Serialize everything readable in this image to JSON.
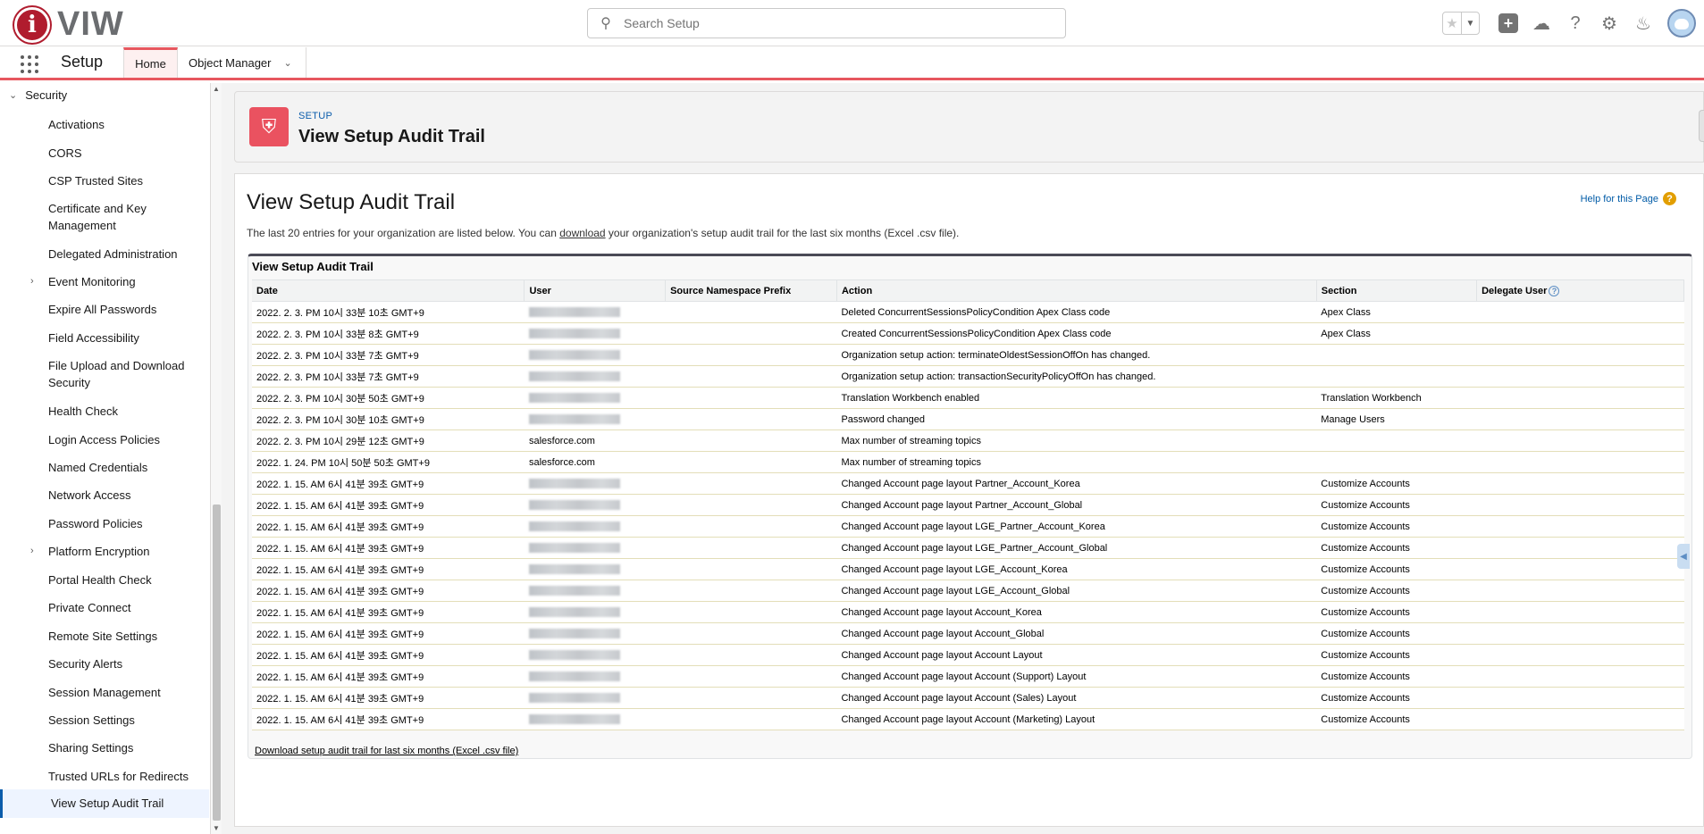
{
  "header": {
    "logo_letter": "i",
    "logo_text": "VIW",
    "search_placeholder": "Search Setup",
    "icons": [
      "star-icon",
      "chevron-down-icon",
      "plus-icon",
      "trailhead-icon",
      "help-icon",
      "gear-icon",
      "bell-icon",
      "avatar"
    ]
  },
  "context_bar": {
    "app_name": "Setup",
    "tabs": [
      {
        "label": "Home",
        "active": true
      },
      {
        "label": "Object Manager",
        "active": false
      }
    ]
  },
  "sidebar": {
    "group_label": "Security",
    "items": [
      {
        "label": "Activations"
      },
      {
        "label": "CORS"
      },
      {
        "label": "CSP Trusted Sites"
      },
      {
        "label": "Certificate and Key Management"
      },
      {
        "label": "Delegated Administration"
      },
      {
        "label": "Event Monitoring",
        "expandable": true
      },
      {
        "label": "Expire All Passwords"
      },
      {
        "label": "Field Accessibility"
      },
      {
        "label": "File Upload and Download Security"
      },
      {
        "label": "Health Check"
      },
      {
        "label": "Login Access Policies"
      },
      {
        "label": "Named Credentials"
      },
      {
        "label": "Network Access"
      },
      {
        "label": "Password Policies"
      },
      {
        "label": "Platform Encryption",
        "expandable": true
      },
      {
        "label": "Portal Health Check"
      },
      {
        "label": "Private Connect"
      },
      {
        "label": "Remote Site Settings"
      },
      {
        "label": "Security Alerts"
      },
      {
        "label": "Session Management"
      },
      {
        "label": "Session Settings"
      },
      {
        "label": "Sharing Settings"
      },
      {
        "label": "Trusted URLs for Redirects"
      },
      {
        "label": "View Setup Audit Trail",
        "active": true
      }
    ]
  },
  "page_header": {
    "eyebrow": "SETUP",
    "title": "View Setup Audit Trail"
  },
  "content": {
    "title": "View Setup Audit Trail",
    "help_link": "Help for this Page",
    "intro_before": "The last 20 entries for your organization are listed below. You can ",
    "intro_link": "download",
    "intro_after": " your organization's setup audit trail for the last six months (Excel .csv file).",
    "block_title": "View Setup Audit Trail",
    "columns": [
      "Date",
      "User",
      "Source Namespace Prefix",
      "Action",
      "Section",
      "Delegate User"
    ],
    "rows": [
      {
        "date": "2022. 2. 3. PM 10시 33분 10초 GMT+9",
        "user": "",
        "prefix": "",
        "action": "Deleted ConcurrentSessionsPolicyCondition Apex Class code",
        "section": "Apex Class",
        "delegate": ""
      },
      {
        "date": "2022. 2. 3. PM 10시 33분 8초 GMT+9",
        "user": "",
        "prefix": "",
        "action": "Created ConcurrentSessionsPolicyCondition Apex Class code",
        "section": "Apex Class",
        "delegate": ""
      },
      {
        "date": "2022. 2. 3. PM 10시 33분 7초 GMT+9",
        "user": "",
        "prefix": "",
        "action": "Organization setup action: terminateOldestSessionOffOn has changed.",
        "section": "",
        "delegate": ""
      },
      {
        "date": "2022. 2. 3. PM 10시 33분 7초 GMT+9",
        "user": "",
        "prefix": "",
        "action": "Organization setup action: transactionSecurityPolicyOffOn has changed.",
        "section": "",
        "delegate": ""
      },
      {
        "date": "2022. 2. 3. PM 10시 30분 50초 GMT+9",
        "user": "",
        "prefix": "",
        "action": "Translation Workbench enabled",
        "section": "Translation Workbench",
        "delegate": ""
      },
      {
        "date": "2022. 2. 3. PM 10시 30분 10초 GMT+9",
        "user": "",
        "prefix": "",
        "action": "Password changed",
        "section": "Manage Users",
        "delegate": ""
      },
      {
        "date": "2022. 2. 3. PM 10시 29분 12초 GMT+9",
        "user": "salesforce.com",
        "prefix": "",
        "action": "Max number of streaming topics",
        "section": "",
        "delegate": ""
      },
      {
        "date": "2022. 1. 24. PM 10시 50분 50초 GMT+9",
        "user": "salesforce.com",
        "prefix": "",
        "action": "Max number of streaming topics",
        "section": "",
        "delegate": ""
      },
      {
        "date": "2022. 1. 15. AM 6시 41분 39초 GMT+9",
        "user": "",
        "prefix": "",
        "action": "Changed Account page layout Partner_Account_Korea",
        "section": "Customize Accounts",
        "delegate": ""
      },
      {
        "date": "2022. 1. 15. AM 6시 41분 39초 GMT+9",
        "user": "",
        "prefix": "",
        "action": "Changed Account page layout Partner_Account_Global",
        "section": "Customize Accounts",
        "delegate": ""
      },
      {
        "date": "2022. 1. 15. AM 6시 41분 39초 GMT+9",
        "user": "",
        "prefix": "",
        "action": "Changed Account page layout LGE_Partner_Account_Korea",
        "section": "Customize Accounts",
        "delegate": ""
      },
      {
        "date": "2022. 1. 15. AM 6시 41분 39초 GMT+9",
        "user": "",
        "prefix": "",
        "action": "Changed Account page layout LGE_Partner_Account_Global",
        "section": "Customize Accounts",
        "delegate": ""
      },
      {
        "date": "2022. 1. 15. AM 6시 41분 39초 GMT+9",
        "user": "",
        "prefix": "",
        "action": "Changed Account page layout LGE_Account_Korea",
        "section": "Customize Accounts",
        "delegate": ""
      },
      {
        "date": "2022. 1. 15. AM 6시 41분 39초 GMT+9",
        "user": "",
        "prefix": "",
        "action": "Changed Account page layout LGE_Account_Global",
        "section": "Customize Accounts",
        "delegate": ""
      },
      {
        "date": "2022. 1. 15. AM 6시 41분 39초 GMT+9",
        "user": "",
        "prefix": "",
        "action": "Changed Account page layout Account_Korea",
        "section": "Customize Accounts",
        "delegate": ""
      },
      {
        "date": "2022. 1. 15. AM 6시 41분 39초 GMT+9",
        "user": "",
        "prefix": "",
        "action": "Changed Account page layout Account_Global",
        "section": "Customize Accounts",
        "delegate": ""
      },
      {
        "date": "2022. 1. 15. AM 6시 41분 39초 GMT+9",
        "user": "",
        "prefix": "",
        "action": "Changed Account page layout Account Layout",
        "section": "Customize Accounts",
        "delegate": ""
      },
      {
        "date": "2022. 1. 15. AM 6시 41분 39초 GMT+9",
        "user": "",
        "prefix": "",
        "action": "Changed Account page layout Account (Support) Layout",
        "section": "Customize Accounts",
        "delegate": ""
      },
      {
        "date": "2022. 1. 15. AM 6시 41분 39초 GMT+9",
        "user": "",
        "prefix": "",
        "action": "Changed Account page layout Account (Sales) Layout",
        "section": "Customize Accounts",
        "delegate": ""
      },
      {
        "date": "2022. 1. 15. AM 6시 41분 39초 GMT+9",
        "user": "",
        "prefix": "",
        "action": "Changed Account page layout Account (Marketing) Layout",
        "section": "Customize Accounts",
        "delegate": ""
      }
    ],
    "download_link": "Download setup audit trail for last six months (Excel .csv file)"
  }
}
